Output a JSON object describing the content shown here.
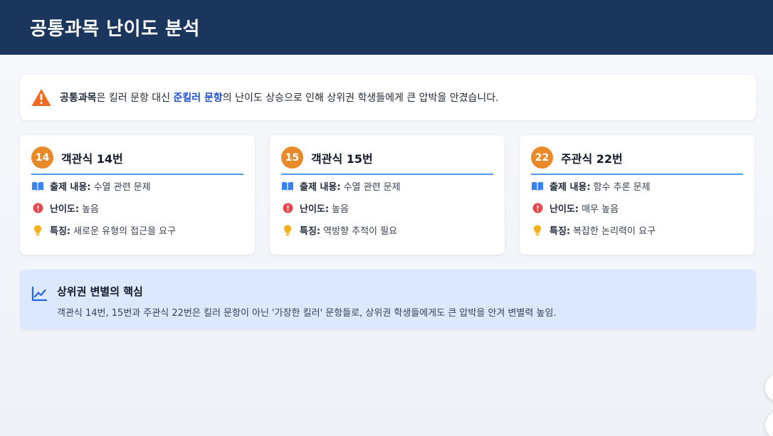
{
  "header": {
    "title": "공통과목 난이도 분석"
  },
  "notice": {
    "bold_prefix": "공통과목",
    "text_a": "은 킬러 문항 대신 ",
    "highlight": "준킬러 문항",
    "text_b": "의 난이도 상승으로 인해 상위권 학생들에게 큰 압박을 안겼습니다."
  },
  "cards": [
    {
      "num": "14",
      "title": "객관식 14번",
      "content_label": "출제 내용:",
      "content_value": "수열 관련 문제",
      "difficulty_label": "난이도:",
      "difficulty_value": "높음",
      "feature_label": "특징:",
      "feature_value": "새로운 유형의 접근을 요구"
    },
    {
      "num": "15",
      "title": "객관식 15번",
      "content_label": "출제 내용:",
      "content_value": "수열 관련 문제",
      "difficulty_label": "난이도:",
      "difficulty_value": "높음",
      "feature_label": "특징:",
      "feature_value": "역방향 추적이 필요"
    },
    {
      "num": "22",
      "title": "주관식 22번",
      "content_label": "출제 내용:",
      "content_value": "함수 추론 문제",
      "difficulty_label": "난이도:",
      "difficulty_value": "매우 높음",
      "feature_label": "특징:",
      "feature_value": "복잡한 논리력이 요구"
    }
  ],
  "insight": {
    "title": "상위권 변별의 핵심",
    "text": "객관식 14번, 15번과 주관식 22번은 킬러 문항이 아닌 '가장한 킬러' 문항들로, 상위권 학생들에게도 큰 압박을 안겨 변별력 높임."
  },
  "icons": {
    "warning": "warning-triangle-icon",
    "content": "book-open-icon",
    "difficulty": "exclamation-circle-icon",
    "feature": "lightbulb-icon",
    "insight": "chart-line-icon"
  },
  "colors": {
    "header_bg": "#1b365d",
    "accent_orange": "#e98a2a",
    "accent_blue": "#4f9bea",
    "danger": "#e5484d",
    "insight_bg": "#dbe8fd"
  }
}
